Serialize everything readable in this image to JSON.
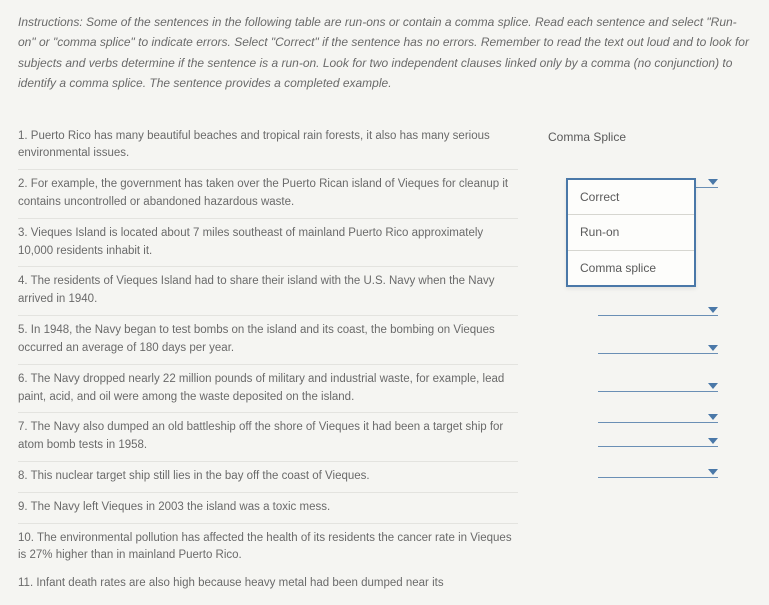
{
  "instructions": "Instructions: Some of the sentences in the following table are run-ons or contain a comma splice. Read each sentence and select \"Run-on\" or \"comma splice\" to indicate errors. Select \"Correct\" if the sentence has no errors. Remember to read the text out loud and to look for subjects and verbs determine if the sentence is a run-on. Look for two independent clauses linked only by a comma (no conjunction) to identify a comma splice. The sentence provides a completed example.",
  "example_answer": "Comma Splice",
  "dropdown_options": [
    "Correct",
    "Run-on",
    "Comma splice"
  ],
  "questions": [
    {
      "n": "1.",
      "text": "Puerto Rico has many beautiful beaches and tropical rain forests, it also has many serious environmental issues."
    },
    {
      "n": "2.",
      "text": "For example, the government has taken over the Puerto Rican island of Vieques for cleanup it contains uncontrolled or abandoned hazardous waste."
    },
    {
      "n": "3.",
      "text": "Vieques Island is located about 7 miles southeast of mainland Puerto Rico approximately 10,000 residents inhabit it."
    },
    {
      "n": "4.",
      "text": "The residents of Vieques Island had to share their island with the U.S. Navy when the Navy arrived in 1940."
    },
    {
      "n": "5.",
      "text": "In 1948, the Navy began to test bombs on the island and its coast, the bombing on Vieques occurred an average of 180 days per year."
    },
    {
      "n": "6.",
      "text": "The Navy dropped nearly 22 million pounds of military and industrial waste, for example, lead paint, acid, and oil were among the waste deposited on the island."
    },
    {
      "n": "7.",
      "text": "The Navy also dumped an old battleship off the shore of Vieques it had been a target ship for atom bomb tests in 1958."
    },
    {
      "n": "8.",
      "text": "This nuclear target ship still lies in the bay off the coast of Vieques."
    },
    {
      "n": "9.",
      "text": "The Navy left Vieques in 2003 the island was a toxic mess."
    },
    {
      "n": "10.",
      "text": "The environmental pollution has affected the health of its residents the cancer rate in Vieques is 27% higher than in mainland Puerto Rico."
    }
  ],
  "cutoff_text": "11. Infant death rates are also high because heavy metal had been dumped near its"
}
